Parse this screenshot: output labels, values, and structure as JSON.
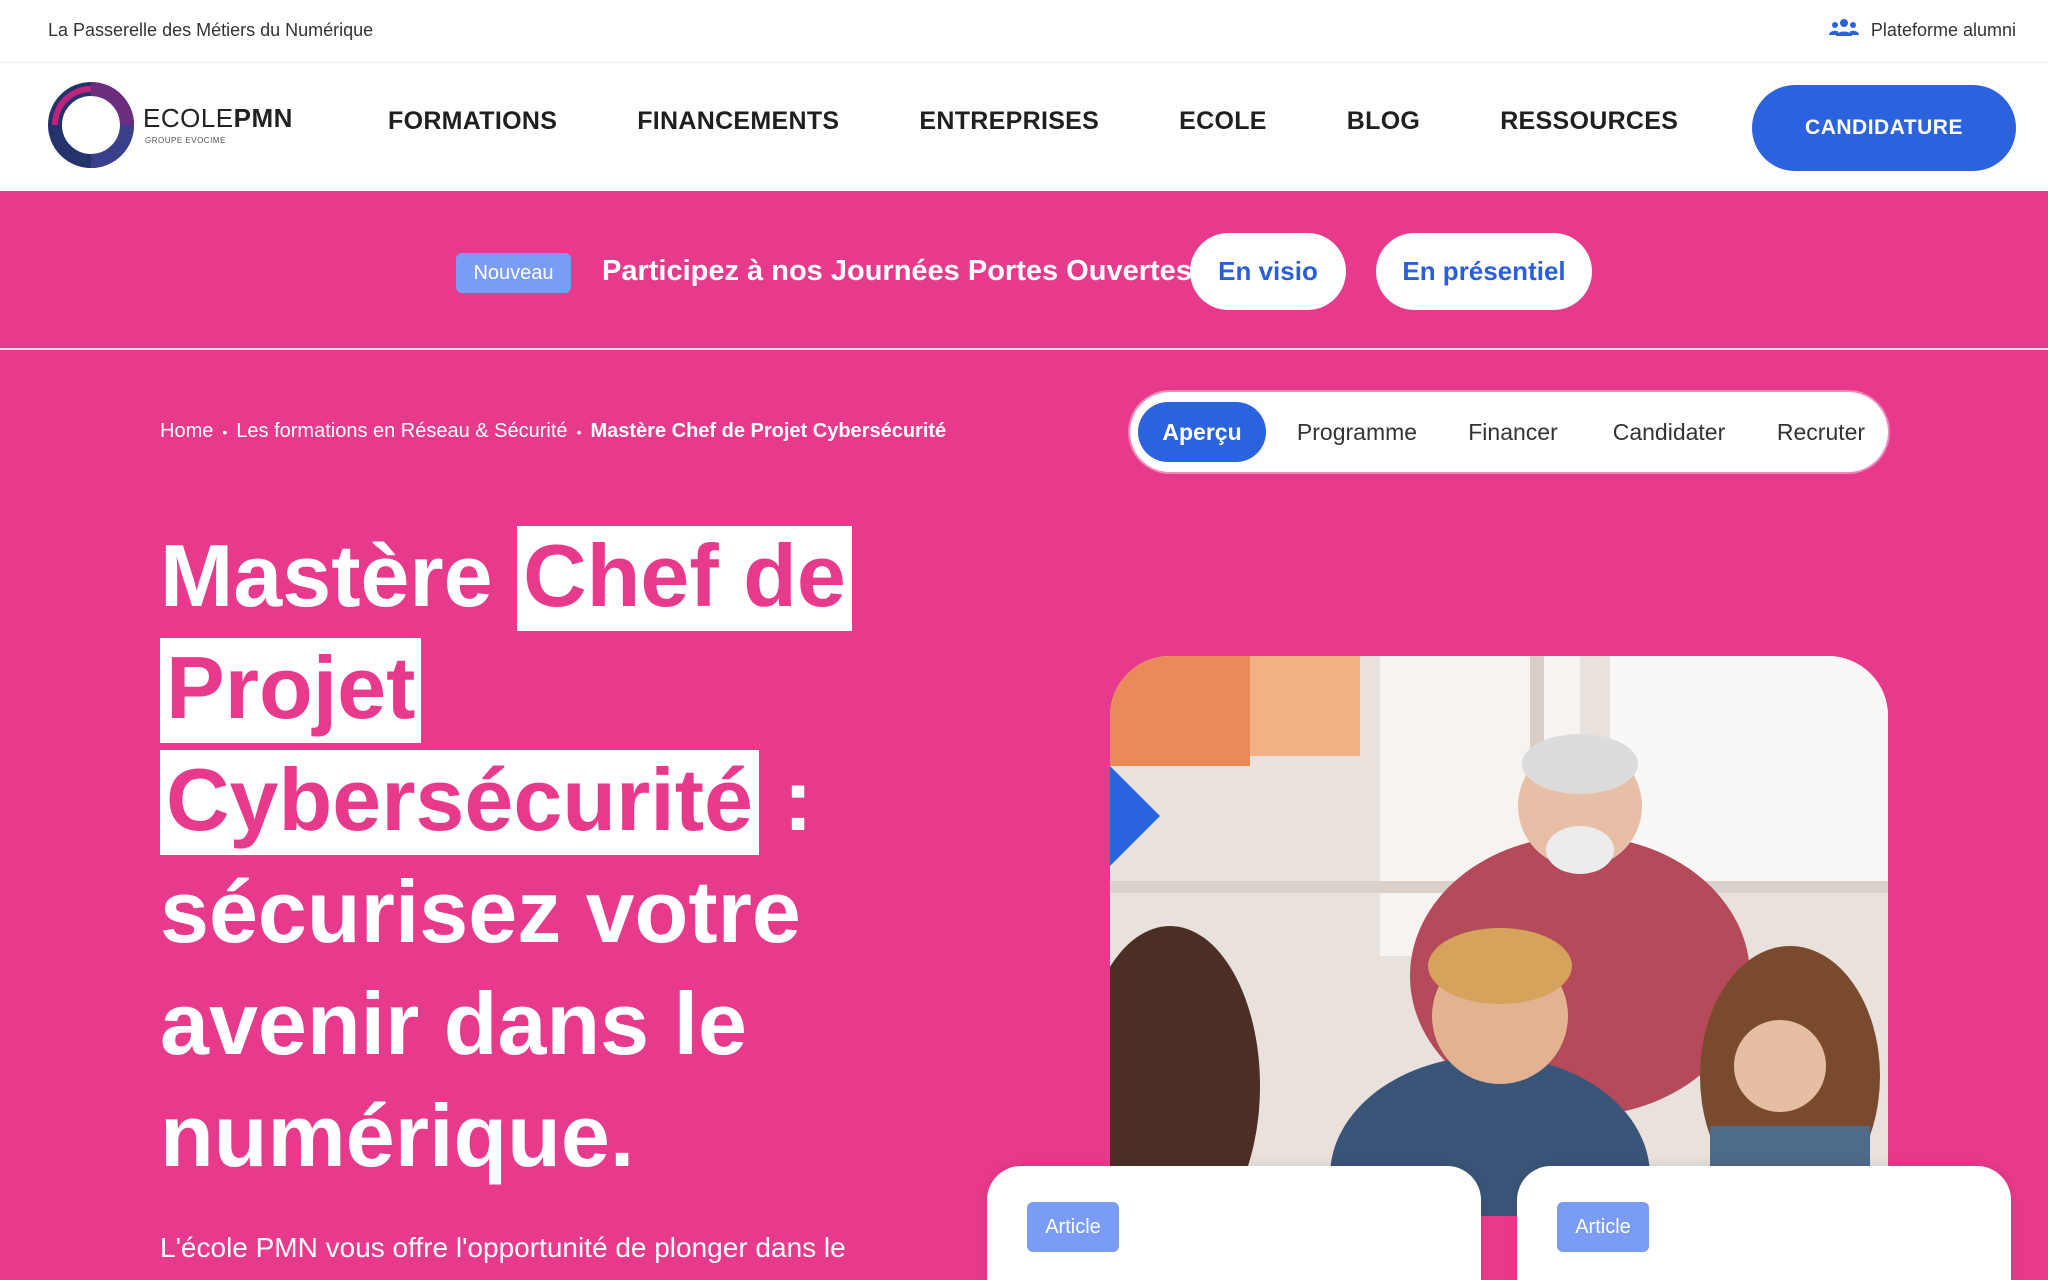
{
  "topbar": {
    "tagline": "La Passerelle des Métiers du Numérique",
    "alumni_label": "Plateforme alumni",
    "alumni_icon": "users-icon"
  },
  "logo": {
    "brand_light": "ECOLE",
    "brand_bold": "PMN",
    "sub": "GROUPE EVOCIME"
  },
  "nav": {
    "items": [
      "FORMATIONS",
      "FINANCEMENTS",
      "ENTREPRISES",
      "ECOLE",
      "BLOG",
      "RESSOURCES"
    ],
    "cta": "CANDIDATURE"
  },
  "promo": {
    "badge": "Nouveau",
    "text": "Participez à nos Journées Portes Ouvertes",
    "btn_visio": "En visio",
    "btn_presentiel": "En présentiel"
  },
  "breadcrumb": {
    "home": "Home",
    "category": "Les formations en Réseau & Sécurité",
    "current": "Mastère Chef de Projet Cybersécurité",
    "sep": "•"
  },
  "tabs": [
    "Aperçu",
    "Programme",
    "Financer",
    "Candidater",
    "Recruter"
  ],
  "hero": {
    "title_1": "Mastère ",
    "title_hl_1": "Chef de",
    "title_hl_2": "Projet",
    "title_hl_3": "Cybersécurité",
    "title_2": " : sécurisez votre avenir dans le numérique.",
    "description": "L'école PMN vous offre l'opportunité de plonger dans le"
  },
  "cards": [
    {
      "tag": "Article"
    },
    {
      "tag": "Article"
    }
  ],
  "colors": {
    "brand_pink": "#e83a8c",
    "brand_blue": "#2b63df",
    "badge_blue": "#7a9cf4"
  }
}
